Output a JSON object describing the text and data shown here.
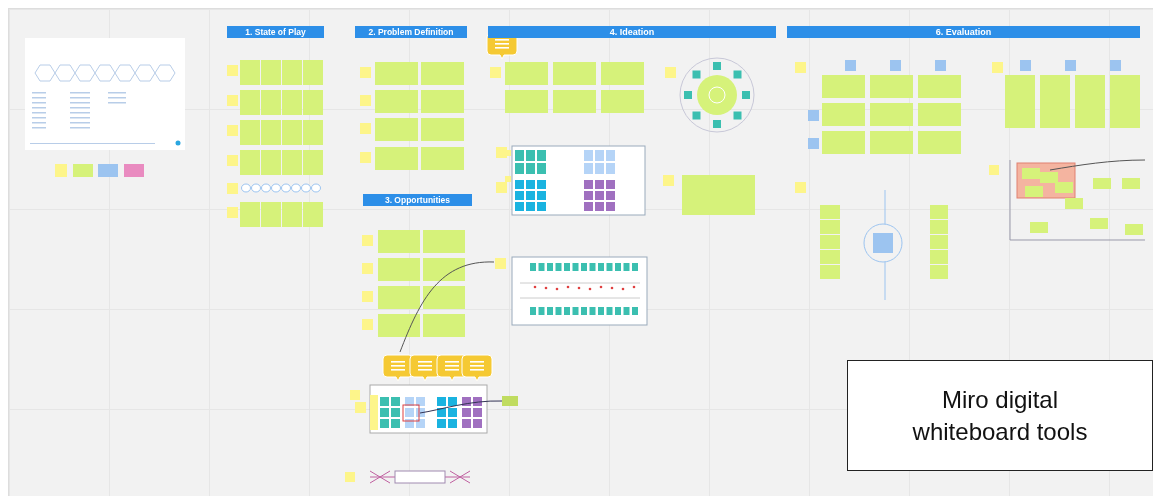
{
  "board": {
    "sections": [
      {
        "label": "1. State of Play",
        "kind": "narrow"
      },
      {
        "label": "2. Problem Definition",
        "kind": "narrow"
      },
      {
        "label": "4. Ideation",
        "kind": "wide"
      },
      {
        "label": "6. Evaluation",
        "kind": "wide"
      },
      {
        "label": "3. Opportunities",
        "kind": "narrow"
      }
    ]
  },
  "caption": "Miro digital whiteboard tools"
}
